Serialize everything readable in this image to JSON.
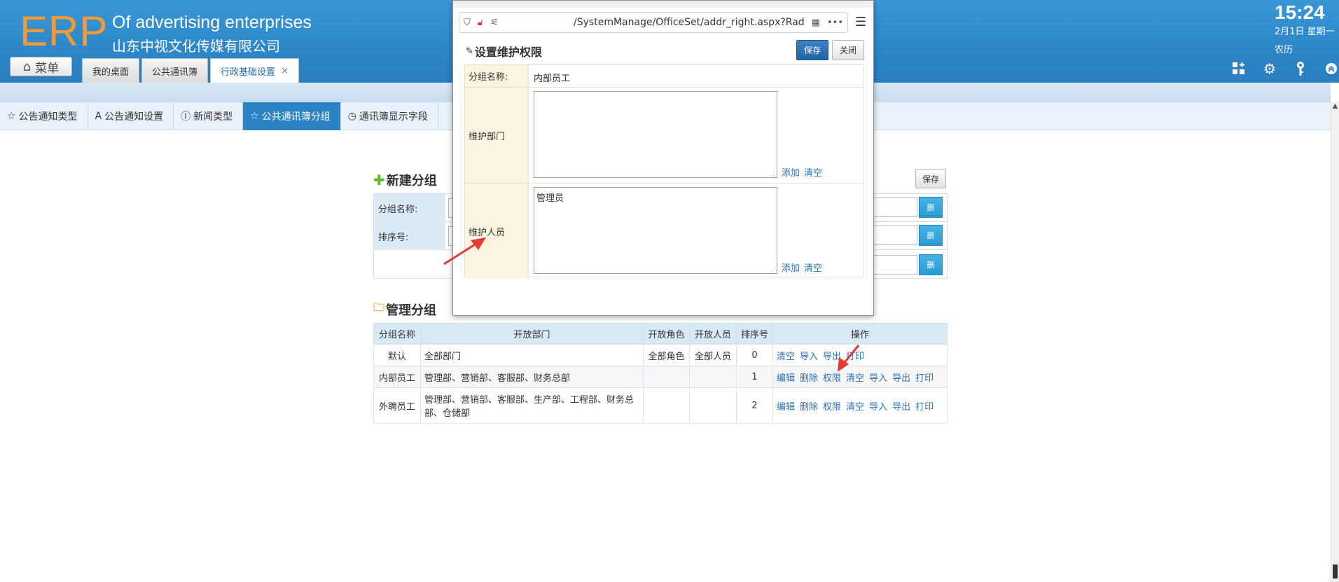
{
  "header": {
    "logo": "ERP",
    "brand_en": "Of advertising enterprises",
    "brand_cn": "山东中视文化传媒有限公司",
    "menu_label": "菜单",
    "tabs": [
      {
        "label": "我的桌面"
      },
      {
        "label": "公共通讯簿"
      },
      {
        "label": "行政基础设置",
        "close": "×"
      }
    ],
    "clock": "15:24",
    "date": "2月1日 星期一",
    "lunar": "农历",
    "icons": [
      "grid-add-icon",
      "gear-icon",
      "key-icon",
      "collapse-up-icon"
    ]
  },
  "secnav": {
    "items": [
      {
        "icon": "☆",
        "label": "公告通知类型"
      },
      {
        "icon": "A",
        "label": "公告通知设置"
      },
      {
        "icon": "Ⓘ",
        "label": "新闻类型"
      },
      {
        "icon": "☆",
        "label": "公共通讯簿分组"
      },
      {
        "icon": "◷",
        "label": "通讯簿显示字段"
      }
    ]
  },
  "new_group": {
    "title": "新建分组",
    "save_label": "保存",
    "name_label": "分组名称:",
    "order_label": "排序号:",
    "del_label": "删"
  },
  "manage_group": {
    "title": "管理分组",
    "headers": [
      "分组名称",
      "开放部门",
      "开放角色",
      "开放人员",
      "排序号",
      "操作"
    ],
    "rows": [
      {
        "name": "默认",
        "dept": "全部部门",
        "role": "全部角色",
        "person": "全部人员",
        "order": "0",
        "actions": [
          "清空",
          "导入",
          "导出",
          "打印"
        ]
      },
      {
        "name": "内部员工",
        "dept": "管理部、营销部、客服部、财务总部",
        "role": "",
        "person": "",
        "order": "1",
        "actions": [
          "编辑",
          "删除",
          "权限",
          "清空",
          "导入",
          "导出",
          "打印"
        ]
      },
      {
        "name": "外聘员工",
        "dept": "管理部、营销部、客服部、生产部、工程部、财务总部、仓储部",
        "role": "",
        "person": "",
        "order": "2",
        "actions": [
          "编辑",
          "删除",
          "权限",
          "清空",
          "导入",
          "导出",
          "打印"
        ]
      }
    ]
  },
  "dialog": {
    "url": "/SystemManage/OfficeSet/addr_right.aspx?Rad",
    "title": "设置维护权限",
    "save_label": "保存",
    "close_label": "关闭",
    "name_label": "分组名称:",
    "name_value": "内部员工",
    "dept_label": "维护部门",
    "dept_value": "",
    "person_label": "维护人员",
    "person_value": "管理员",
    "add_label": "添加",
    "clear_label": "清空"
  },
  "colors": {
    "header_blue": "#2b84c6",
    "logo_orange": "#f29a3a",
    "active_tab": "#2b83c4",
    "link_blue": "#2b72b5",
    "arrow_red": "#e53935"
  }
}
